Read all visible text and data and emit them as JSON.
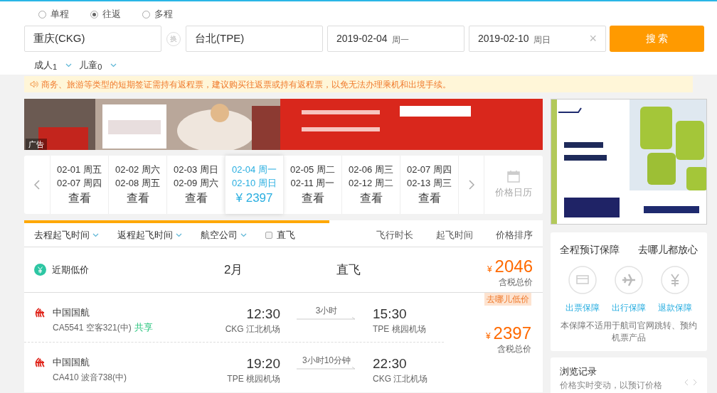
{
  "trip_types": [
    {
      "label": "单程",
      "selected": false
    },
    {
      "label": "往返",
      "selected": true
    },
    {
      "label": "多程",
      "selected": false
    }
  ],
  "search": {
    "from": "重庆(CKG)",
    "swap": "换",
    "to": "台北(TPE)",
    "depart": {
      "date": "2019-02-04",
      "weekday": "周一"
    },
    "return": {
      "date": "2019-02-10",
      "weekday": "周日"
    },
    "clear": "×",
    "button": "搜 索"
  },
  "passengers": [
    {
      "label": "成人",
      "count": "1"
    },
    {
      "label": "儿童",
      "count": "0"
    }
  ],
  "notice": "商务、旅游等类型的短期签证需持有返程票，建议购买往返票或持有返程票，以免无法办理乘机和出境手续。",
  "banner": {
    "kind": "picture",
    "tag": "广告"
  },
  "date_strip": {
    "items": [
      {
        "depart": "02-01 周五",
        "return": "02-07 周四",
        "price": "查看",
        "selected": false
      },
      {
        "depart": "02-02 周六",
        "return": "02-08 周五",
        "price": "查看",
        "selected": false
      },
      {
        "depart": "02-03 周日",
        "return": "02-09 周六",
        "price": "查看",
        "selected": false
      },
      {
        "depart": "02-04 周一",
        "return": "02-10 周日",
        "price": "¥ 2397",
        "selected": true
      },
      {
        "depart": "02-05 周二",
        "return": "02-11 周一",
        "price": "查看",
        "selected": false
      },
      {
        "depart": "02-06 周三",
        "return": "02-12 周二",
        "price": "查看",
        "selected": false
      },
      {
        "depart": "02-07 周四",
        "return": "02-13 周三",
        "price": "查看",
        "selected": false
      }
    ],
    "calendar_label": "价格日历"
  },
  "filters": [
    {
      "label": "去程起飞时间",
      "kind": "dropdown"
    },
    {
      "label": "返程起飞时间",
      "kind": "dropdown"
    },
    {
      "label": "航空公司",
      "kind": "dropdown"
    },
    {
      "label": "直飞",
      "kind": "checkbox",
      "checked": false
    }
  ],
  "sorts": [
    "飞行时长",
    "起飞时间",
    "价格排序"
  ],
  "summary": {
    "label": "近期低价",
    "month": "2月",
    "type": "直飞",
    "currency": "¥",
    "price": "2046",
    "note": "含税总价"
  },
  "result": {
    "badge": "去哪儿低价",
    "currency": "¥",
    "price": "2397",
    "note": "含税总价",
    "legs": [
      {
        "airline": "中国国航",
        "flight": "CA5541 空客321(中)",
        "shared": "共享",
        "depart_time": "12:30",
        "depart_airport": "CKG 江北机场",
        "duration": "3小时",
        "arrive_time": "15:30",
        "arrive_airport": "TPE 桃园机场"
      },
      {
        "airline": "中国国航",
        "flight": "CA410 波音738(中)",
        "depart_time": "19:20",
        "depart_airport": "TPE 桃园机场",
        "duration": "3小时10分钟",
        "arrive_time": "22:30",
        "arrive_airport": "CKG 江北机场"
      }
    ]
  },
  "side_ad": {
    "kind": "picture"
  },
  "guarantee": {
    "title": "全程预订保障",
    "slogan": "去哪儿都放心",
    "items": [
      {
        "label": "出票保障",
        "kind": "card"
      },
      {
        "label": "出行保障",
        "kind": "plane"
      },
      {
        "label": "退款保障",
        "kind": "yen"
      }
    ],
    "note": "本保障不适用于航司官网跳转、预约机票产品"
  },
  "history": {
    "title": "浏览记录",
    "note": "价格实时变动，以预订价格"
  }
}
